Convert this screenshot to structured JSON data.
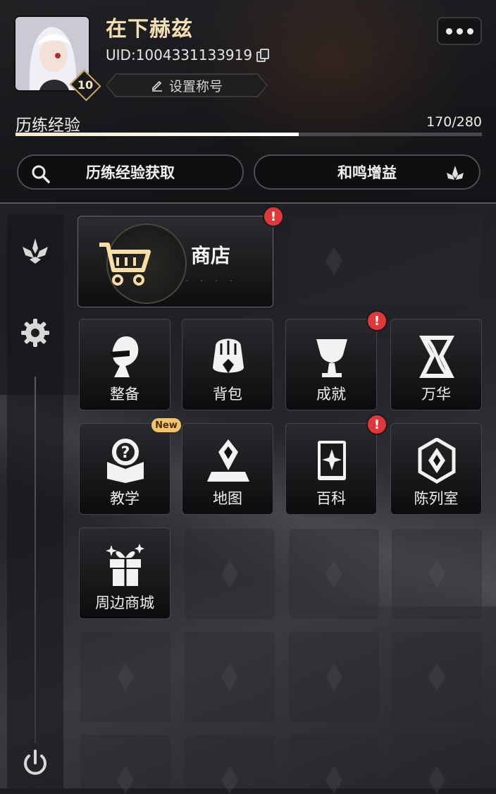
{
  "profile": {
    "username": "在下赫兹",
    "uid": "UID:1004331133919",
    "level": "10",
    "set_title_label": "设置称号"
  },
  "experience": {
    "label": "历练经验",
    "value_text": "170/280",
    "current": 170,
    "max": 280
  },
  "actions": {
    "exp_source_label": "历练经验获取",
    "resonance_label": "和鸣增益"
  },
  "shop": {
    "label": "商店",
    "has_alert": true,
    "alert_mark": "!"
  },
  "grid": {
    "row1": [
      "整备",
      "背包",
      "成就",
      "万华"
    ],
    "row2": [
      "教学",
      "地图",
      "百科",
      "陈列室"
    ],
    "row3": [
      "周边商城"
    ],
    "new_badge": "New"
  },
  "colors": {
    "username": "#f3dfb2",
    "alert": "#e0373a",
    "new_badge": "#f2c46a"
  }
}
